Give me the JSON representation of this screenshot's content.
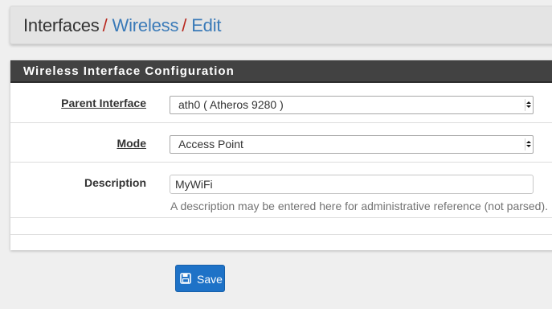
{
  "breadcrumb": {
    "root": "Interfaces",
    "separator": "/",
    "items": [
      "Wireless",
      "Edit"
    ]
  },
  "panel": {
    "title": "Wireless Interface Configuration",
    "fields": {
      "parent_interface": {
        "label": "Parent Interface",
        "value": "ath0 ( Atheros 9280 )"
      },
      "mode": {
        "label": "Mode",
        "value": "Access Point"
      },
      "description": {
        "label": "Description",
        "value": "MyWiFi",
        "help": "A description may be entered here for administrative reference (not parsed)."
      }
    }
  },
  "actions": {
    "save_label": "Save",
    "save_icon": "floppy-disk-icon"
  },
  "colors": {
    "panel_heading_bg": "#424242",
    "link": "#3a7ab8",
    "separator": "#b8271e",
    "primary_button": "#1e72c7"
  }
}
